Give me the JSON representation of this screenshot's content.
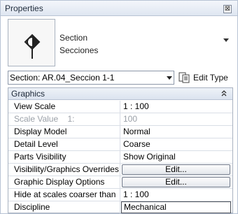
{
  "panel": {
    "title": "Properties",
    "close_glyph": "⊠"
  },
  "type_selector": {
    "family": "Section",
    "type": "Secciones",
    "thumbnail_icon": "section-head-icon"
  },
  "instance_selector": {
    "value": "Section: AR.04_Seccion 1-1",
    "edit_type_label": "Edit Type",
    "edit_type_icon": "edit-type-icon"
  },
  "group": {
    "label": "Graphics",
    "collapse_glyph": "≈"
  },
  "rows": [
    {
      "name": "View Scale",
      "value": "1 : 100",
      "kind": "text",
      "disabled": false
    },
    {
      "name": "Scale Value    1:",
      "value": "100",
      "kind": "text",
      "disabled": true
    },
    {
      "name": "Display Model",
      "value": "Normal",
      "kind": "text",
      "disabled": false
    },
    {
      "name": "Detail Level",
      "value": "Coarse",
      "kind": "text",
      "disabled": false
    },
    {
      "name": "Parts Visibility",
      "value": "Show Original",
      "kind": "text",
      "disabled": false
    },
    {
      "name": "Visibility/Graphics Overrides",
      "value": "Edit...",
      "kind": "button",
      "disabled": false
    },
    {
      "name": "Graphic Display Options",
      "value": "Edit...",
      "kind": "button",
      "disabled": false
    },
    {
      "name": "Hide at scales coarser than",
      "value": "1 : 100",
      "kind": "text",
      "disabled": false
    },
    {
      "name": "Discipline",
      "value": "Mechanical",
      "kind": "input",
      "disabled": false
    }
  ]
}
